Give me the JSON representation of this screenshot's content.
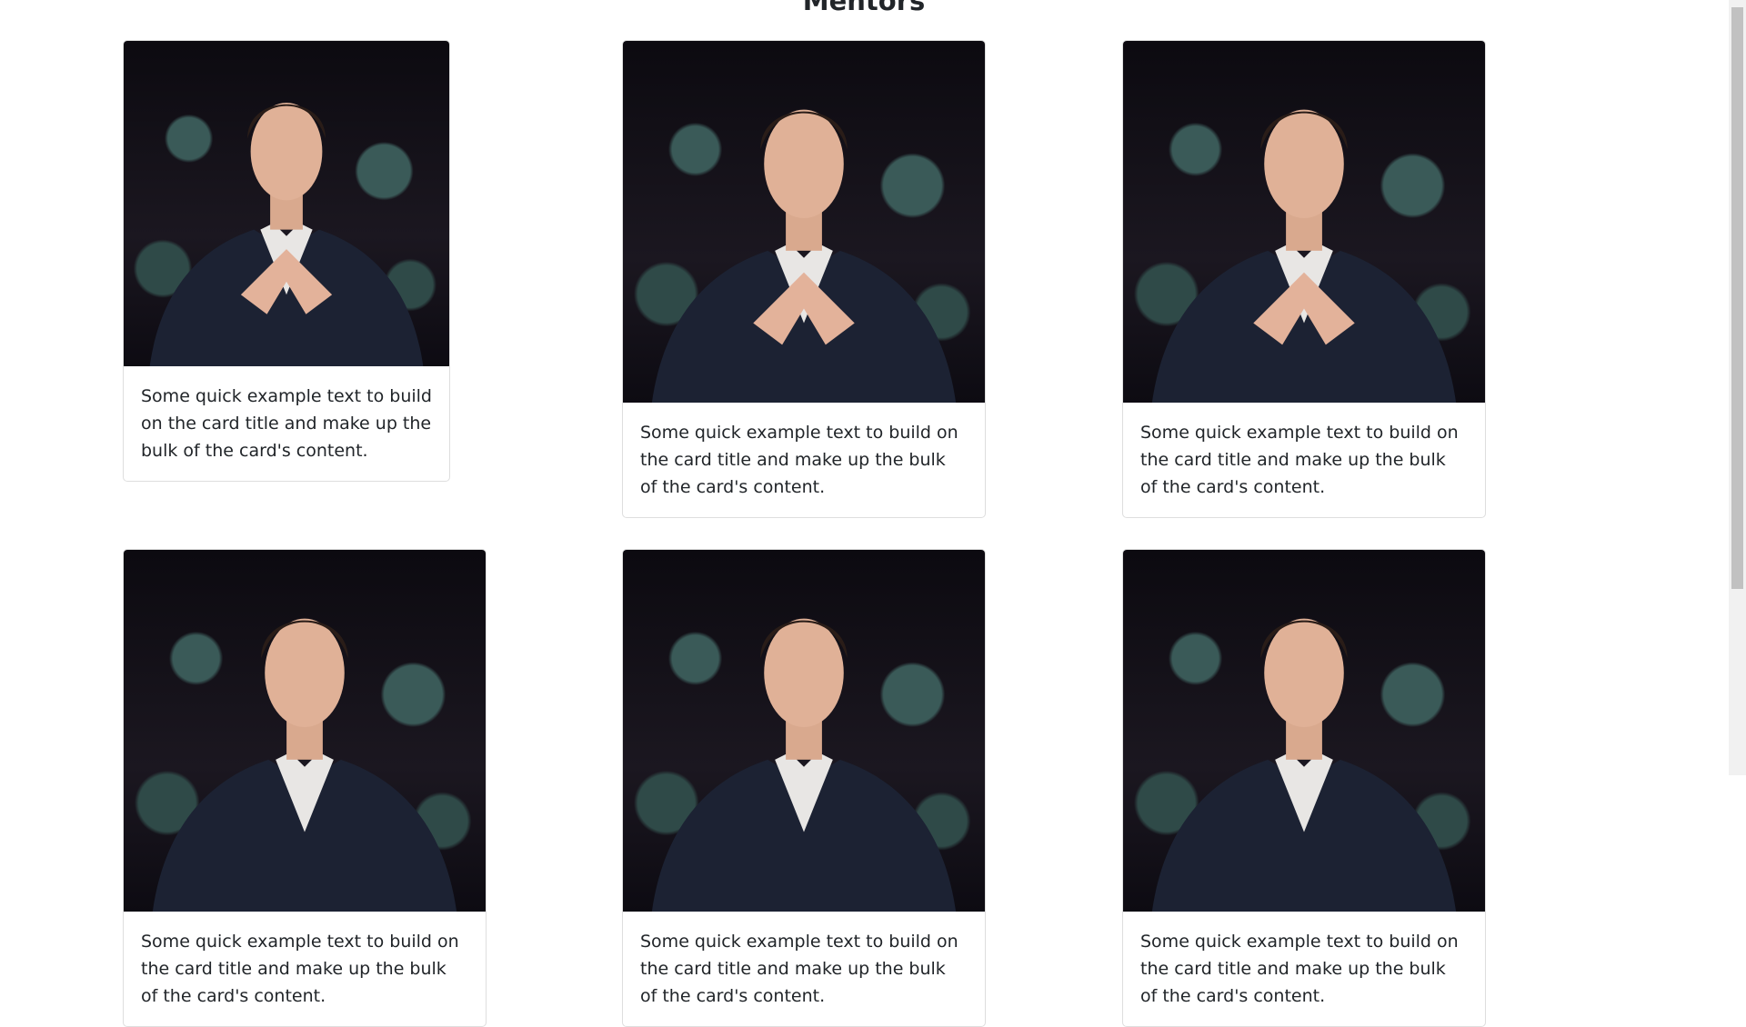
{
  "page": {
    "title": "Mentors"
  },
  "cards": [
    {
      "text": "Some quick example text to build on the card title and make up the bulk of the card's content.",
      "image_alt": "Mentor photo"
    },
    {
      "text": "Some quick example text to build on the card title and make up the bulk of the card's content.",
      "image_alt": "Mentor photo"
    },
    {
      "text": "Some quick example text to build on the card title and make up the bulk of the card's content.",
      "image_alt": "Mentor photo"
    },
    {
      "text": "Some quick example text to build on the card title and make up the bulk of the card's content.",
      "image_alt": "Mentor photo"
    },
    {
      "text": "Some quick example text to build on the card title and make up the bulk of the card's content.",
      "image_alt": "Mentor photo"
    },
    {
      "text": "Some quick example text to build on the card title and make up the bulk of the card's content.",
      "image_alt": "Mentor photo"
    }
  ],
  "colors": {
    "text": "#212529",
    "card_border": "#dee2e6",
    "photo_background": "#15121a",
    "suit": "#1c2233"
  }
}
